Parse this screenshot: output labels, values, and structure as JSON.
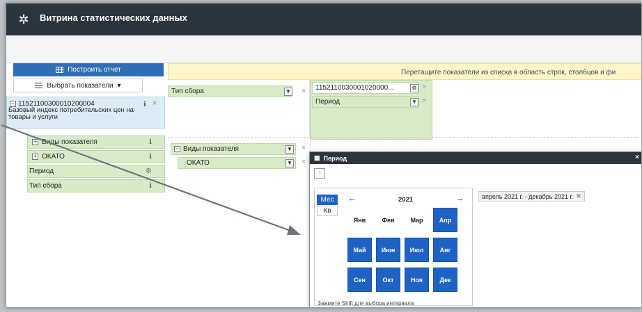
{
  "app": {
    "title": "Витрина статистических данных",
    "logo_icon": "eagle-emblem-icon"
  },
  "left_panel": {
    "build_label": "Построить отчет",
    "choose_label": "Выбрать показатели",
    "indicator": {
      "code": "11521100300010200004",
      "description": "Базовый индекс потребительских цен на товары и услуги"
    },
    "dimensions": [
      {
        "label": "Виды показателя",
        "expandable": true,
        "icon": "info-icon"
      },
      {
        "label": "ОКАТО",
        "expandable": true,
        "icon": "info-icon"
      },
      {
        "label": "Период",
        "expandable": false,
        "icon": "gear-icon"
      },
      {
        "label": "Тип сбора",
        "expandable": false,
        "icon": "info-icon"
      }
    ]
  },
  "workspace": {
    "hint": "Перетащите показатели из списка в область строк, столбцов и фи",
    "filter_fields": [
      {
        "label": "Тип сбора"
      }
    ],
    "column_fields": [
      {
        "label": "1152110030001020000..."
      },
      {
        "label": "Период"
      }
    ],
    "row_fields": [
      {
        "label": "Виды показателя"
      },
      {
        "label": "ОКАТО"
      }
    ]
  },
  "dialog": {
    "title": "Период",
    "close": "×",
    "mode_month": "Мес",
    "mode_quarter": "Кв",
    "year": "2021",
    "months": [
      "Янв",
      "Фев",
      "Мар",
      "Апр",
      "Май",
      "Июн",
      "Июл",
      "Авг",
      "Сен",
      "Окт",
      "Ноя",
      "Дек"
    ],
    "selected_months": [
      "Апр",
      "Май",
      "Июн",
      "Июл",
      "Авг",
      "Сен",
      "Окт",
      "Ноя",
      "Дек"
    ],
    "shift_hint": "Зажмите Shift для выбора интервала",
    "range": "апрель 2021 г. - декабрь 2021 г."
  },
  "colors": {
    "header": "#2b3540",
    "accent": "#1e63c3",
    "field": "#d8ebc8",
    "hint": "#fdf6c8",
    "indicator": "#dcecf6"
  }
}
